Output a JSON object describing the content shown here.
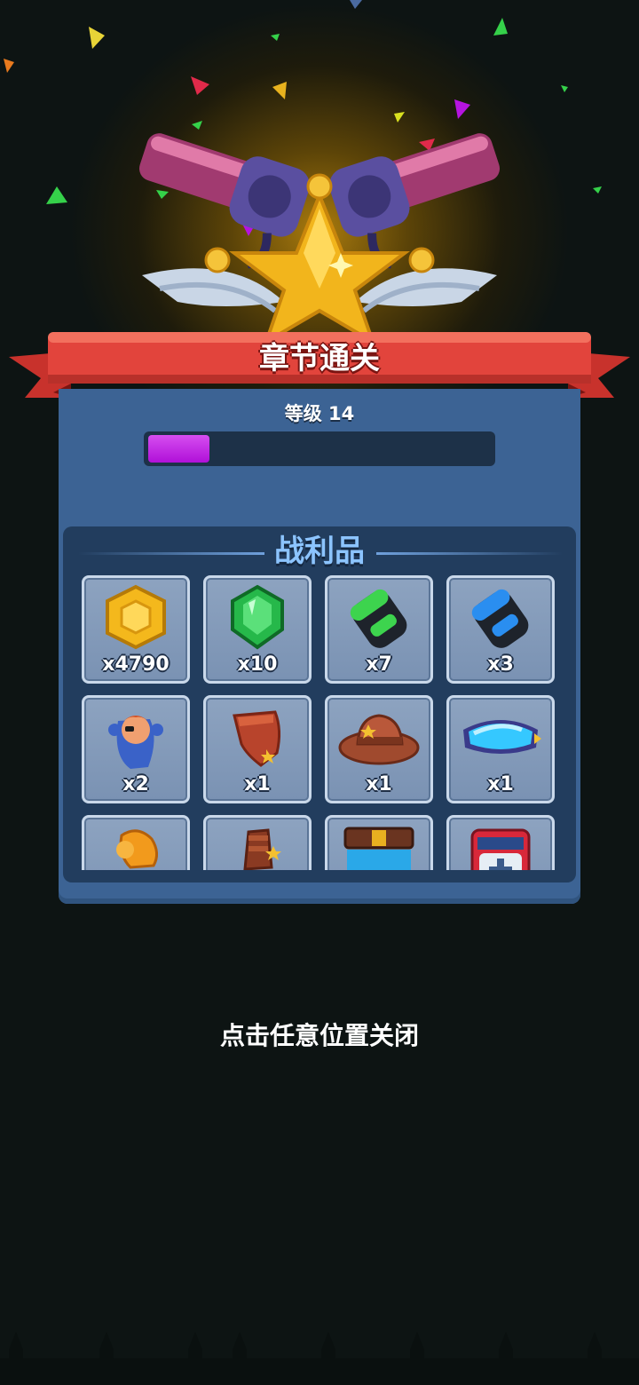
{
  "banner": {
    "title": "章节通关"
  },
  "level": {
    "label": "等级 14",
    "progress": 0.18
  },
  "loot": {
    "title": "战利品",
    "items": [
      {
        "icon": "gold-coin-icon",
        "count": "x4790"
      },
      {
        "icon": "green-gem-icon",
        "count": "x10"
      },
      {
        "icon": "green-canister-icon",
        "count": "x7"
      },
      {
        "icon": "blue-canister-icon",
        "count": "x3"
      },
      {
        "icon": "hero-card-icon",
        "count": "x2"
      },
      {
        "icon": "leather-glove-icon",
        "count": "x1"
      },
      {
        "icon": "cowboy-hat-icon",
        "count": "x1"
      },
      {
        "icon": "goggles-icon",
        "count": "x1"
      },
      {
        "icon": "boxing-glove-icon",
        "count": ""
      },
      {
        "icon": "gauntlet-icon",
        "count": ""
      },
      {
        "icon": "belt-pants-icon",
        "count": ""
      },
      {
        "icon": "medkit-icon",
        "count": ""
      }
    ]
  },
  "hint": "点击任意位置关闭",
  "colors": {
    "accent": "#b010d8",
    "panel": "#3c6394",
    "banner": "#e2443c",
    "loot_title": "#8cc4ff"
  }
}
